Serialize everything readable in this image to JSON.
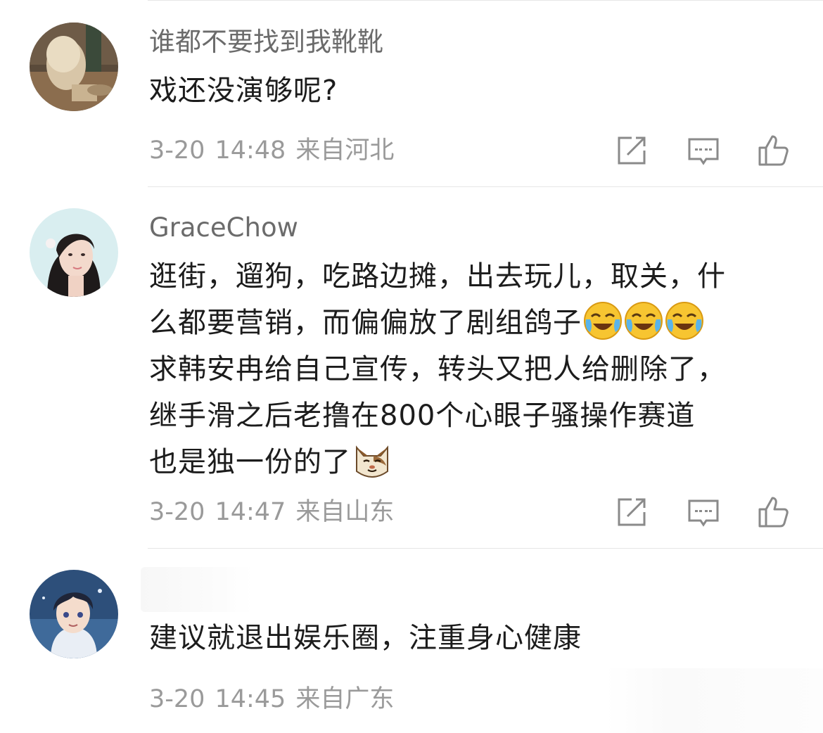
{
  "comments": [
    {
      "username": "谁都不要找到我靴靴",
      "text_lines": [
        "戏还没演够呢?"
      ],
      "date": "3-20",
      "time": "14:48",
      "location": "来自河北",
      "avatar": "photo-girl-icon"
    },
    {
      "username": "GraceChow",
      "text_lines": [
        "逛街，遛狗，吃路边摊，出去玩儿，取关，什",
        "么都要营销，而偏偏放了剧组鸽子",
        "求韩安冉给自己宣传，转头又把人给删除了，",
        "继手滑之后老撸在800个心眼子骚操作赛道",
        "也是独一份的了"
      ],
      "emojis_line2": [
        "laughing-crying-emoji",
        "laughing-crying-emoji",
        "laughing-crying-emoji"
      ],
      "emoji_line5": "cat-smile-emoji",
      "date": "3-20",
      "time": "14:47",
      "location": "来自山东",
      "avatar": "woman-portrait-icon"
    },
    {
      "username": "",
      "text_lines": [
        "建议就退出娱乐圈，注重身心健康"
      ],
      "date": "3-20",
      "time": "14:45",
      "location": "来自广东",
      "avatar": "anime-boy-icon"
    }
  ],
  "actions": [
    "share-icon",
    "comment-icon",
    "like-icon"
  ],
  "colors": {
    "username": "#6b6b6b",
    "text": "#1c1c1c",
    "meta": "#9a9a9a",
    "icon": "#8a8a8a",
    "divider": "#e6e6e6"
  }
}
